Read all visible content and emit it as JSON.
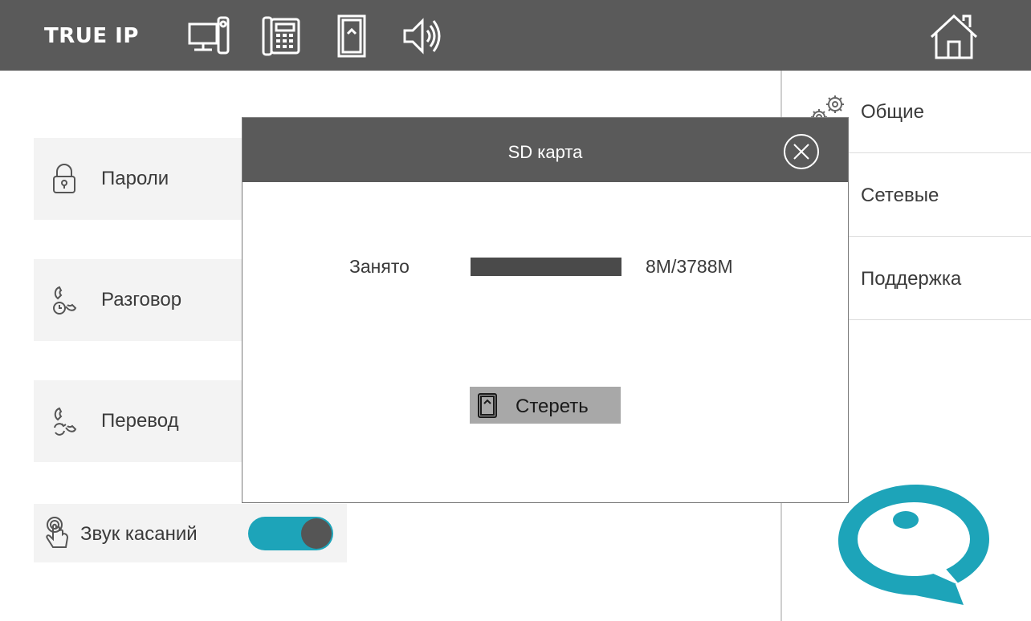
{
  "app": {
    "brand": "TRUE IP"
  },
  "topbar": {
    "icons": [
      "monitor-intercom-icon",
      "desk-phone-icon",
      "sd-card-icon",
      "speaker-icon"
    ],
    "home_icon": "home-icon",
    "color": "#5a5a5a"
  },
  "left_menu": {
    "items": [
      {
        "label": "Пароли",
        "icon": "lock-icon"
      },
      {
        "label": "Разговор",
        "icon": "call-timer-icon"
      },
      {
        "label": "Перевод",
        "icon": "call-transfer-icon"
      }
    ],
    "touch_sound": {
      "label": "Звук касаний",
      "icon": "touch-icon",
      "enabled": true,
      "accent": "#1da4b9"
    }
  },
  "right_menu": {
    "items": [
      {
        "label": "Общие",
        "icon": "gears-icon"
      },
      {
        "label": "Сетевые"
      },
      {
        "label": "Поддержка"
      }
    ]
  },
  "dialog": {
    "title": "SD карта",
    "used_label": "Занято",
    "used_value": "8M/3788M",
    "used_fraction": 1.0,
    "erase_label": "Стереть",
    "erase_icon": "sd-card-icon",
    "close_icon": "close-icon"
  },
  "logo": {
    "color": "#1da4b9"
  }
}
